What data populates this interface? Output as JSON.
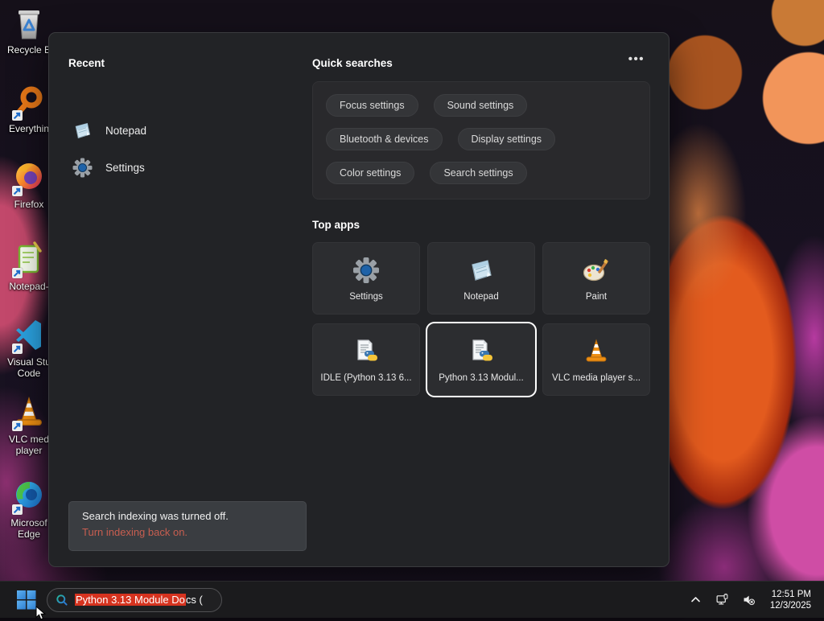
{
  "desktop": {
    "icons": [
      {
        "id": "recycle-bin",
        "label_lines": [
          "Recycle B"
        ]
      },
      {
        "id": "everything",
        "label_lines": [
          "Everythin"
        ]
      },
      {
        "id": "firefox",
        "label_lines": [
          "Firefox"
        ]
      },
      {
        "id": "notepad-plus",
        "label_lines": [
          "Notepad-"
        ]
      },
      {
        "id": "vscode",
        "label_lines": [
          "Visual Stu",
          "Code"
        ]
      },
      {
        "id": "vlc",
        "label_lines": [
          "VLC med",
          "player"
        ]
      },
      {
        "id": "edge",
        "label_lines": [
          "Microsof",
          "Edge"
        ]
      }
    ]
  },
  "search_panel": {
    "recent": {
      "header": "Recent",
      "items": [
        {
          "label": "Notepad",
          "icon": "notepad-icon"
        },
        {
          "label": "Settings",
          "icon": "settings-gear-icon"
        }
      ]
    },
    "quick_searches": {
      "header": "Quick searches",
      "more_button": "•••",
      "pills": [
        [
          "Focus settings",
          "Sound settings"
        ],
        [
          "Bluetooth & devices",
          "Display settings"
        ],
        [
          "Color settings",
          "Search settings"
        ]
      ]
    },
    "top_apps": {
      "header": "Top apps",
      "tiles": [
        {
          "label": "Settings",
          "icon": "settings-gear-icon",
          "selected": false
        },
        {
          "label": "Notepad",
          "icon": "notepad-icon",
          "selected": false
        },
        {
          "label": "Paint",
          "icon": "paint-icon",
          "selected": false
        },
        {
          "label": "IDLE (Python 3.13 6...",
          "icon": "python-doc-icon",
          "selected": false
        },
        {
          "label": "Python 3.13 Modul...",
          "icon": "python-doc-icon",
          "selected": true
        },
        {
          "label": "VLC media player s...",
          "icon": "vlc-cone-icon",
          "selected": false
        }
      ]
    },
    "notification": {
      "line1": "Search indexing was turned off.",
      "link": "Turn indexing back on.",
      "link_color": "#c75e50"
    }
  },
  "taskbar": {
    "search": {
      "highlighted_text": "Python 3.13 Module Do",
      "rest_text": "cs (",
      "highlight_color": "#d6331f"
    },
    "tray": {
      "time": "12:51 PM",
      "date": "12/3/2025"
    }
  },
  "colors": {
    "panel_bg": "#222326",
    "tile_bg": "#2c2d30",
    "selected_tile_border": "#ffffff",
    "taskbar_bg": "#1b1b1d"
  }
}
